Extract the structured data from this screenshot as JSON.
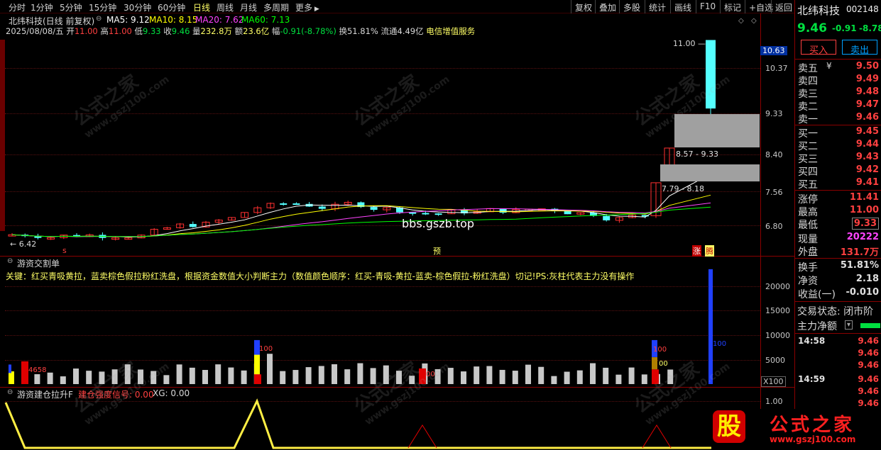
{
  "toolbar": {
    "periods": [
      "分时",
      "1分钟",
      "5分钟",
      "15分钟",
      "30分钟",
      "60分钟",
      "日线",
      "周线",
      "月线",
      "多周期",
      "更多"
    ],
    "active_period": "日线",
    "buttons": [
      "复权",
      "叠加",
      "多股",
      "统计",
      "画线",
      "F10",
      "标记",
      "+自选",
      "返回"
    ]
  },
  "stock": {
    "name": "北纬科技",
    "code": "002148",
    "chart_title": "北纬科技(日线 前复权)",
    "price": "9.46",
    "change": "-0.91",
    "change_pct": "-8.78"
  },
  "ma": {
    "ma5": "MA5: 9.12",
    "ma10": "MA10: 8.15",
    "ma20": "MA20: 7.62",
    "ma60": "MA60: 7.13",
    "colors": {
      "ma5": "#ffffff",
      "ma10": "#ffff00",
      "ma20": "#ff44ff",
      "ma60": "#00ff00"
    }
  },
  "info_line": {
    "date": "2025/08/08/五",
    "open_lbl": "开",
    "open": "11.00",
    "high_lbl": "高",
    "high": "11.00",
    "low_lbl": "低",
    "low": "9.33",
    "close_lbl": "收",
    "close": "9.46",
    "vol_lbl": "量",
    "vol": "232.8万",
    "amt_lbl": "额",
    "amt": "23.6亿",
    "chg_lbl": "幅",
    "chg": "-0.91(-8.78%)",
    "turn": "换51.81%",
    "float": "流通4.49亿",
    "sector": "电信增值服务"
  },
  "main_chart": {
    "y_axis": [
      "10.37",
      "9.33",
      "8.40",
      "7.56",
      "6.80"
    ],
    "current_price_tag": "10.63",
    "low_marker": "6.42",
    "high_marker": "11.00",
    "gap_label_1": "8.57 - 9.33",
    "gap_label_2": "7.79 - 8.18",
    "watermark_text": "bbs.gszb.top",
    "bottom_markers": {
      "s": "s",
      "yu": "预",
      "zhang": "涨",
      "teng": "腾"
    }
  },
  "panel2": {
    "title": "游资交割单",
    "description": "关键：红买青吸黄拉，蓝卖棕色假拉粉红洗盘，根据资金数值大小判断主力（数值颜色顺序：红买-青吸-黄拉-蓝卖-棕色假拉-粉红洗盘）切记!PS:灰柱代表主力没有操作",
    "y_axis": [
      "20000",
      "15000",
      "10000",
      "5000"
    ],
    "scale": "X100",
    "labels": [
      "4658",
      "100",
      "100",
      "100",
      "00",
      "00"
    ]
  },
  "panel3": {
    "title": "游资建仓拉升F",
    "signal_label": "建仓强度信号: 0.00",
    "xg_label": "XG: 0.00",
    "y_axis": [
      "1.00"
    ]
  },
  "right_panel": {
    "buy_button": "买入",
    "sell_button": "卖出",
    "asks": [
      {
        "label": "卖五",
        "mark": "¥",
        "price": "9.50"
      },
      {
        "label": "卖四",
        "mark": "",
        "price": "9.49"
      },
      {
        "label": "卖三",
        "mark": "",
        "price": "9.48"
      },
      {
        "label": "卖二",
        "mark": "",
        "price": "9.47"
      },
      {
        "label": "卖一",
        "mark": "",
        "price": "9.46"
      }
    ],
    "bids": [
      {
        "label": "买一",
        "price": "9.45"
      },
      {
        "label": "买二",
        "price": "9.44"
      },
      {
        "label": "买三",
        "price": "9.43"
      },
      {
        "label": "买四",
        "price": "9.42"
      },
      {
        "label": "买五",
        "price": "9.41"
      }
    ],
    "stats": [
      {
        "label": "涨停",
        "value": "11.41",
        "color": "#ff4040"
      },
      {
        "label": "最高",
        "value": "11.00",
        "color": "#ff4040"
      },
      {
        "label": "最低",
        "value": "9.33",
        "color": "#ff4040"
      },
      {
        "label": "现量",
        "value": "20222",
        "color": "#ff44ff"
      },
      {
        "label": "外盘",
        "value": "131.7万",
        "color": "#ff4040"
      }
    ],
    "stats2": [
      {
        "label": "换手",
        "value": "51.81%"
      },
      {
        "label": "净资",
        "value": "2.18"
      },
      {
        "label": "收益(一)",
        "value": "-0.010"
      }
    ],
    "trade_status": "交易状态: 闭市阶",
    "main_net": "主力净额",
    "ticks": [
      {
        "time": "14:58",
        "value": "9.46"
      },
      {
        "time": "",
        "value": "9.46"
      },
      {
        "time": "",
        "value": "9.46"
      },
      {
        "time": "14:59",
        "value": "9.46"
      },
      {
        "time": "",
        "value": "9.46"
      },
      {
        "time": "",
        "value": "9.46"
      }
    ]
  },
  "logo": {
    "badge": "股",
    "text": "公式之家",
    "url": "www.gszj100.com"
  },
  "watermarks": {
    "cn": "公式之家",
    "url": "www.gszj100.com"
  }
}
